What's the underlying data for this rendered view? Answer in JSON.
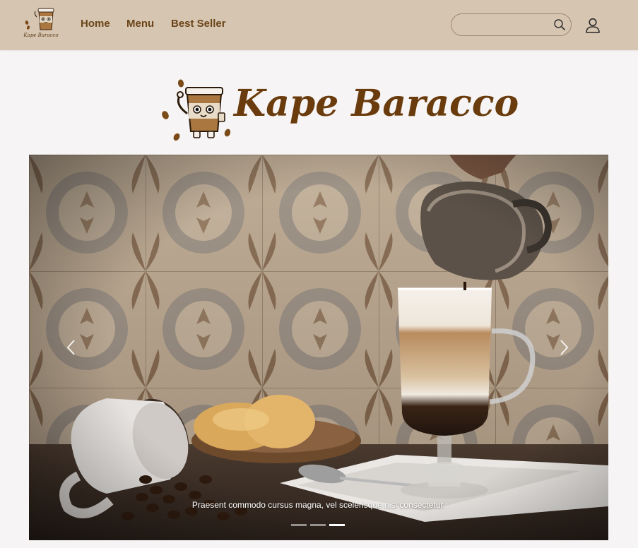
{
  "navbar": {
    "brand_text": "Kape Baracco",
    "links": [
      {
        "label": "Home"
      },
      {
        "label": "Menu"
      },
      {
        "label": "Best Seller"
      }
    ],
    "search": {
      "placeholder": "",
      "value": ""
    },
    "icons": {
      "search": "search-icon",
      "user": "user-icon"
    }
  },
  "hero": {
    "logo_text": "Kape Baracco"
  },
  "carousel": {
    "caption": "Praesent commodo cursus magna, vel scelerisque nisl consectetur.",
    "slide_count": 3,
    "active_slide": 3,
    "icons": {
      "prev": "chevron-left-icon",
      "next": "chevron-right-icon"
    }
  },
  "colors": {
    "navbar_bg": "#d6c5b1",
    "nav_text": "#6a4519",
    "brand_brown": "#6a3b0c",
    "page_bg": "#f6f4f4"
  }
}
